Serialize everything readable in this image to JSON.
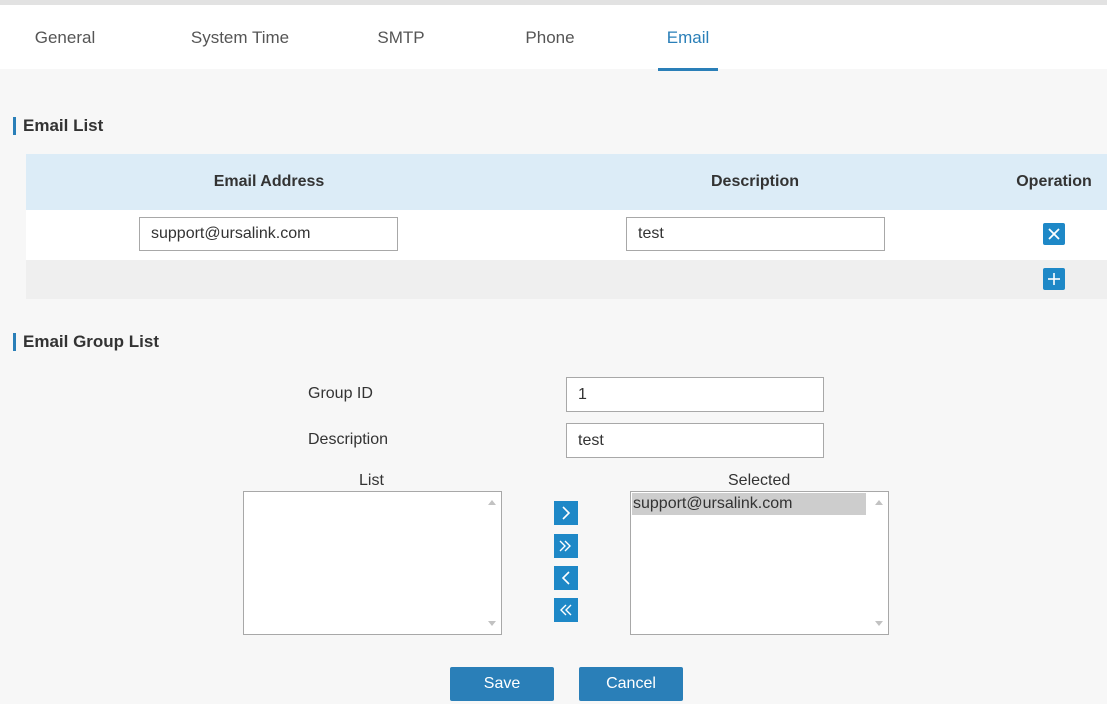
{
  "tabs": [
    {
      "label": "General"
    },
    {
      "label": "System Time"
    },
    {
      "label": "SMTP"
    },
    {
      "label": "Phone"
    },
    {
      "label": "Email",
      "active": true
    }
  ],
  "email_list": {
    "title": "Email List",
    "columns": [
      "Email Address",
      "Description",
      "Operation"
    ],
    "rows": [
      {
        "email": "support@ursalink.com",
        "description": "test"
      }
    ]
  },
  "email_group_list": {
    "title": "Email Group List",
    "group_id_label": "Group ID",
    "group_id_value": "1",
    "description_label": "Description",
    "description_value": "test",
    "list_label": "List",
    "selected_label": "Selected",
    "list_items": [],
    "selected_items": [
      "support@ursalink.com"
    ]
  },
  "buttons": {
    "save": "Save",
    "cancel": "Cancel"
  },
  "colors": {
    "accent": "#2a7fb8",
    "icon_button": "#1e88c7",
    "table_header": "#dcecf7"
  }
}
